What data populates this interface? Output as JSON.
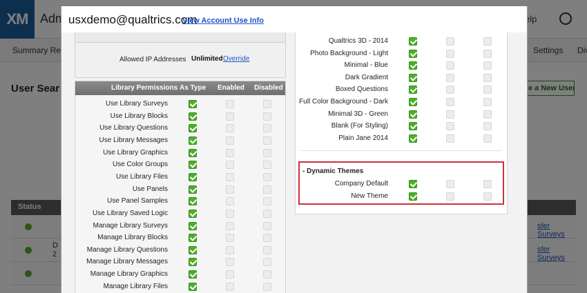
{
  "background": {
    "logo": "XM",
    "app_title": "Adm",
    "help": "elp",
    "nav": [
      "Summary Re",
      "Settings",
      "Div"
    ],
    "page_title": "User Sear",
    "add_user": "e a New User",
    "table_header": "Status",
    "rows": [
      {
        "text": "",
        "link": "sfer Surveys"
      },
      {
        "text": "D\n2",
        "link": "sfer Surveys"
      },
      {
        "text": "",
        "link": ""
      }
    ]
  },
  "modal": {
    "title": "usxdemo@qualtrics.com",
    "view_account_link": "View Account Use Info",
    "allowed_ip": {
      "label": "Allowed IP Addresses",
      "value": "Unlimited",
      "override": "Override"
    },
    "library_permissions": {
      "headers": [
        "Library Permissions",
        "As Type",
        "Enabled",
        "Disabled"
      ],
      "rows": [
        {
          "label": "Use Library Surveys",
          "as_type": true
        },
        {
          "label": "Use Library Blocks",
          "as_type": true
        },
        {
          "label": "Use Library Questions",
          "as_type": true
        },
        {
          "label": "Use Library Messages",
          "as_type": true
        },
        {
          "label": "Use Library Graphics",
          "as_type": true
        },
        {
          "label": "Use Color Groups",
          "as_type": true
        },
        {
          "label": "Use Library Files",
          "as_type": true
        },
        {
          "label": "Use Panels",
          "as_type": true
        },
        {
          "label": "Use Panel Samples",
          "as_type": true
        },
        {
          "label": "Use Library Saved Logic",
          "as_type": true
        },
        {
          "label": "Manage Library Surveys",
          "as_type": true
        },
        {
          "label": "Manage Library Blocks",
          "as_type": true
        },
        {
          "label": "Manage Library Questions",
          "as_type": true
        },
        {
          "label": "Manage Library Messages",
          "as_type": true
        },
        {
          "label": "Manage Library Graphics",
          "as_type": true
        },
        {
          "label": "Manage Library Files",
          "as_type": true
        }
      ]
    },
    "themes": [
      {
        "label": "Qualtrics 3D - 2014",
        "as_type": true
      },
      {
        "label": "Photo Background - Light",
        "as_type": true
      },
      {
        "label": "Minimal - Blue",
        "as_type": true
      },
      {
        "label": "Dark Gradient",
        "as_type": true
      },
      {
        "label": "Boxed Questions",
        "as_type": true
      },
      {
        "label": "Full Color Background - Dark",
        "as_type": true
      },
      {
        "label": "Minimal 3D - Green",
        "as_type": true
      },
      {
        "label": "Blank (For Styling)",
        "as_type": true
      },
      {
        "label": "Plain Jane 2014",
        "as_type": true
      }
    ],
    "dynamic_themes": {
      "title": "- Dynamic Themes",
      "rows": [
        {
          "label": "Company Default",
          "as_type": true
        },
        {
          "label": "New Theme",
          "as_type": true
        }
      ]
    },
    "colors": {
      "checkbox_on": "#4caf28",
      "highlight": "#c8323b",
      "link": "#1a55c2"
    }
  }
}
